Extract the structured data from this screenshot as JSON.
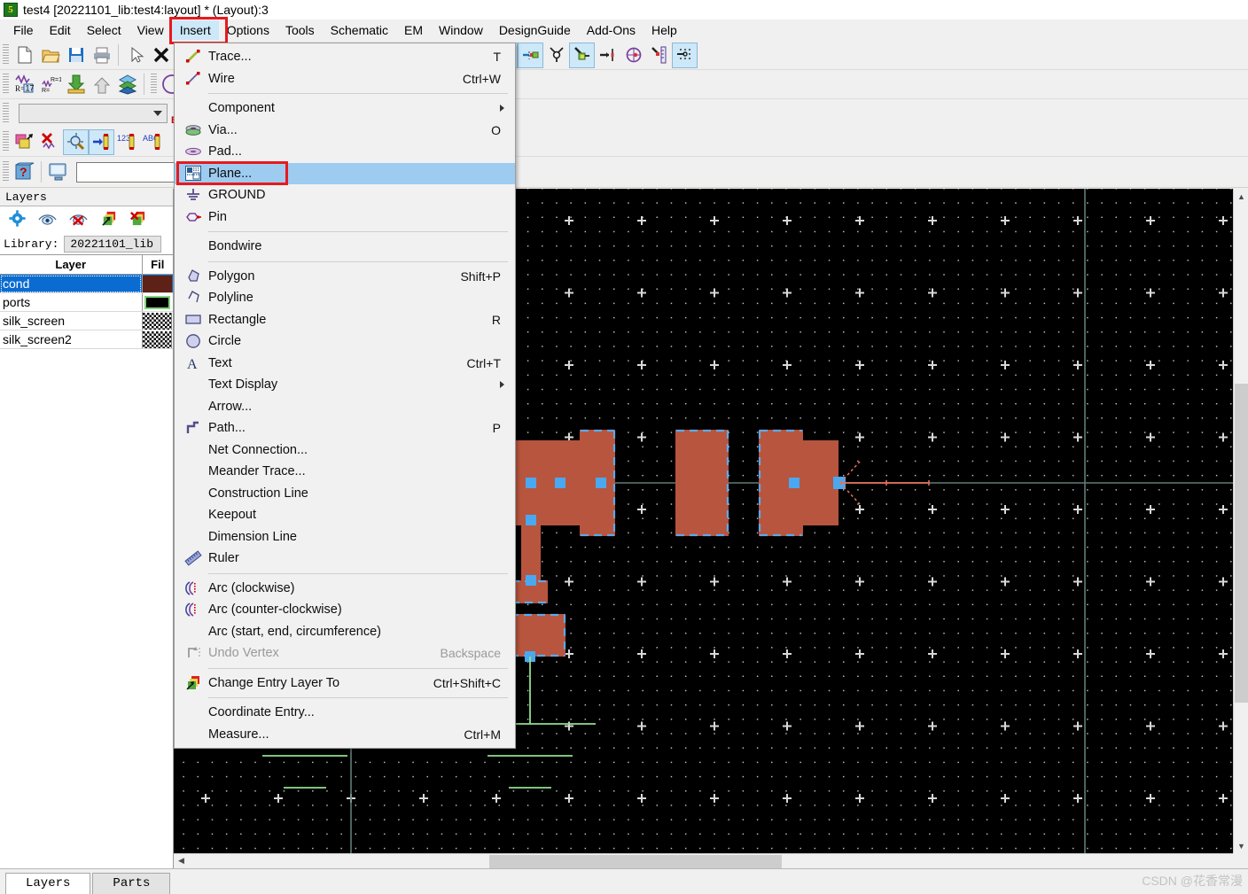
{
  "window": {
    "title": "test4 [20221101_lib:test4:layout] * (Layout):3",
    "logo_glyph": "5"
  },
  "menubar": {
    "items": [
      {
        "label": "File",
        "active": false
      },
      {
        "label": "Edit",
        "active": false
      },
      {
        "label": "Select",
        "active": false
      },
      {
        "label": "View",
        "active": false
      },
      {
        "label": "Insert",
        "active": true
      },
      {
        "label": "Options",
        "active": false
      },
      {
        "label": "Tools",
        "active": false
      },
      {
        "label": "Schematic",
        "active": false
      },
      {
        "label": "EM",
        "active": false
      },
      {
        "label": "Window",
        "active": false
      },
      {
        "label": "DesignGuide",
        "active": false
      },
      {
        "label": "Add-Ons",
        "active": false
      },
      {
        "label": "Help",
        "active": false
      }
    ]
  },
  "insert_menu": {
    "items": [
      {
        "label": "Trace...",
        "accel": "T",
        "icon": "trace-icon",
        "type": "item"
      },
      {
        "label": "Wire",
        "accel": "Ctrl+W",
        "icon": "wire-icon",
        "type": "item"
      },
      {
        "type": "separator"
      },
      {
        "label": "Component",
        "accel": "",
        "icon": "",
        "type": "submenu"
      },
      {
        "label": "Via...",
        "accel": "O",
        "icon": "via-icon",
        "type": "item"
      },
      {
        "label": "Pad...",
        "accel": "",
        "icon": "pad-icon",
        "type": "item"
      },
      {
        "label": "Plane...",
        "accel": "",
        "icon": "plane-icon",
        "type": "item",
        "selected": true
      },
      {
        "label": "GROUND",
        "accel": "",
        "icon": "ground-icon",
        "type": "item"
      },
      {
        "label": "Pin",
        "accel": "",
        "icon": "pin-icon",
        "type": "item"
      },
      {
        "type": "separator"
      },
      {
        "label": "Bondwire",
        "accel": "",
        "icon": "",
        "type": "item"
      },
      {
        "type": "separator"
      },
      {
        "label": "Polygon",
        "accel": "Shift+P",
        "icon": "polygon-icon",
        "type": "item"
      },
      {
        "label": "Polyline",
        "accel": "",
        "icon": "polyline-icon",
        "type": "item"
      },
      {
        "label": "Rectangle",
        "accel": "R",
        "icon": "rectangle-icon",
        "type": "item"
      },
      {
        "label": "Circle",
        "accel": "",
        "icon": "circle-icon",
        "type": "item"
      },
      {
        "label": "Text",
        "accel": "Ctrl+T",
        "icon": "text-icon",
        "type": "item"
      },
      {
        "label": "Text Display",
        "accel": "",
        "icon": "",
        "type": "submenu"
      },
      {
        "label": "Arrow...",
        "accel": "",
        "icon": "",
        "type": "item"
      },
      {
        "label": "Path...",
        "accel": "P",
        "icon": "path-icon",
        "type": "item"
      },
      {
        "label": "Net Connection...",
        "accel": "",
        "icon": "",
        "type": "item"
      },
      {
        "label": "Meander Trace...",
        "accel": "",
        "icon": "",
        "type": "item"
      },
      {
        "label": "Construction Line",
        "accel": "",
        "icon": "",
        "type": "item"
      },
      {
        "label": "Keepout",
        "accel": "",
        "icon": "",
        "type": "item"
      },
      {
        "label": "Dimension Line",
        "accel": "",
        "icon": "",
        "type": "item"
      },
      {
        "label": "Ruler",
        "accel": "",
        "icon": "ruler-icon",
        "type": "item"
      },
      {
        "type": "separator"
      },
      {
        "label": "Arc (clockwise)",
        "accel": "",
        "icon": "arc-cw-icon",
        "type": "item"
      },
      {
        "label": "Arc (counter-clockwise)",
        "accel": "",
        "icon": "arc-ccw-icon",
        "type": "item"
      },
      {
        "label": "Arc (start, end, circumference)",
        "accel": "",
        "icon": "",
        "type": "item"
      },
      {
        "label": "Undo Vertex",
        "accel": "Backspace",
        "icon": "undo-vertex-icon",
        "type": "item",
        "disabled": true
      },
      {
        "type": "separator"
      },
      {
        "label": "Change Entry Layer To",
        "accel": "Ctrl+Shift+C",
        "icon": "change-layer-icon",
        "type": "item"
      },
      {
        "type": "separator"
      },
      {
        "label": "Coordinate Entry...",
        "accel": "",
        "icon": "",
        "type": "item"
      },
      {
        "label": "Measure...",
        "accel": "Ctrl+M",
        "icon": "",
        "type": "item"
      }
    ]
  },
  "layers_panel": {
    "title": "Layers",
    "library_label": "Library:",
    "library_value": "20221101_lib",
    "toolbar_icons": [
      "gear-icon",
      "eye-icon",
      "eye-off-icon",
      "layer-select-icon",
      "layer-deselect-icon"
    ],
    "columns": [
      "Layer",
      "Fil"
    ],
    "rows": [
      {
        "name": "cond",
        "selected": true,
        "fill_color": "#5d2117",
        "fill_style": "solid"
      },
      {
        "name": "ports",
        "selected": false,
        "fill_color": "#000000",
        "fill_style": "outline",
        "outline_color": "#7fd67f"
      },
      {
        "name": "silk_screen",
        "selected": false,
        "fill_color": "#000000",
        "fill_style": "checker"
      },
      {
        "name": "silk_screen2",
        "selected": false,
        "fill_color": "#000000",
        "fill_style": "checker"
      }
    ]
  },
  "bottom_tabs": {
    "items": [
      {
        "label": "Layers",
        "selected": true
      },
      {
        "label": "Parts",
        "selected": false
      }
    ]
  },
  "watermark": "CSDN @花香常漫",
  "canvas": {
    "background": "#000000",
    "copper_color": "#b8553f",
    "selection_handle_color": "#4aa8f0",
    "selection_dash_color": "#5fa8e8",
    "axis_color": "#5e7d78",
    "port_color": "#8fe08f",
    "pin_color": "#e8705c",
    "grid_dot_color": "#e1e1e1",
    "zoom_label": ""
  },
  "scrollbars": {
    "v_up": "▲",
    "v_down": "▼",
    "h_left": "◀"
  }
}
